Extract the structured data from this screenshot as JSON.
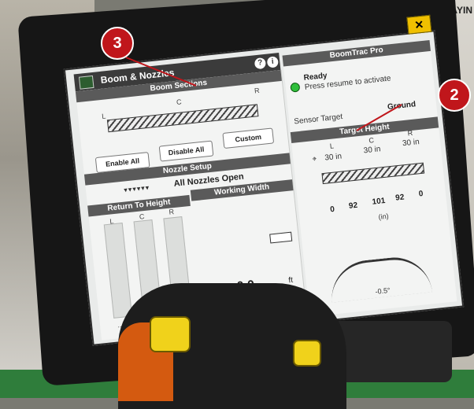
{
  "colors": {
    "badge": "#c0161b",
    "screen": "#e9ebea",
    "bezel": "#161616",
    "accent_yellow": "#f0c000"
  },
  "background_sign": "AYIN",
  "screen": {
    "title": "Boom & Nozzles",
    "close_label": "✕",
    "help_icon": "help-icon",
    "info_icon": "info-icon",
    "boom_sections": {
      "header": "Boom Sections",
      "labels": {
        "l": "L",
        "c": "C",
        "r": "R"
      },
      "buttons": {
        "enable": "Enable All",
        "disable": "Disable All",
        "custom": "Custom"
      }
    },
    "nozzle_setup": {
      "header": "Nozzle Setup",
      "status": "All Nozzles Open"
    },
    "return_to_height": {
      "header": "Return To Height",
      "labels": {
        "l": "L",
        "c": "C",
        "r": "R"
      },
      "dots": "..."
    },
    "working_width": {
      "header": "Working Width",
      "value": "0.0",
      "unit": "ft"
    },
    "boomtrac": {
      "header": "BoomTrac Pro",
      "ready": "Ready",
      "ready_hint": "Press resume to activate",
      "sensor_target_label": "Sensor Target",
      "sensor_target_value": "Ground",
      "target_height": {
        "header": "Target Height",
        "labels": {
          "l": "L",
          "c": "C",
          "r": "R"
        },
        "values": [
          "30 in",
          "30 in",
          "30 in"
        ]
      },
      "sensor_readings": [
        "0",
        "92",
        "101",
        "92",
        "0"
      ],
      "readings_unit": "(in)",
      "tilt": "-0.5°"
    }
  },
  "annotations": [
    {
      "number": "3"
    },
    {
      "number": "2"
    }
  ]
}
